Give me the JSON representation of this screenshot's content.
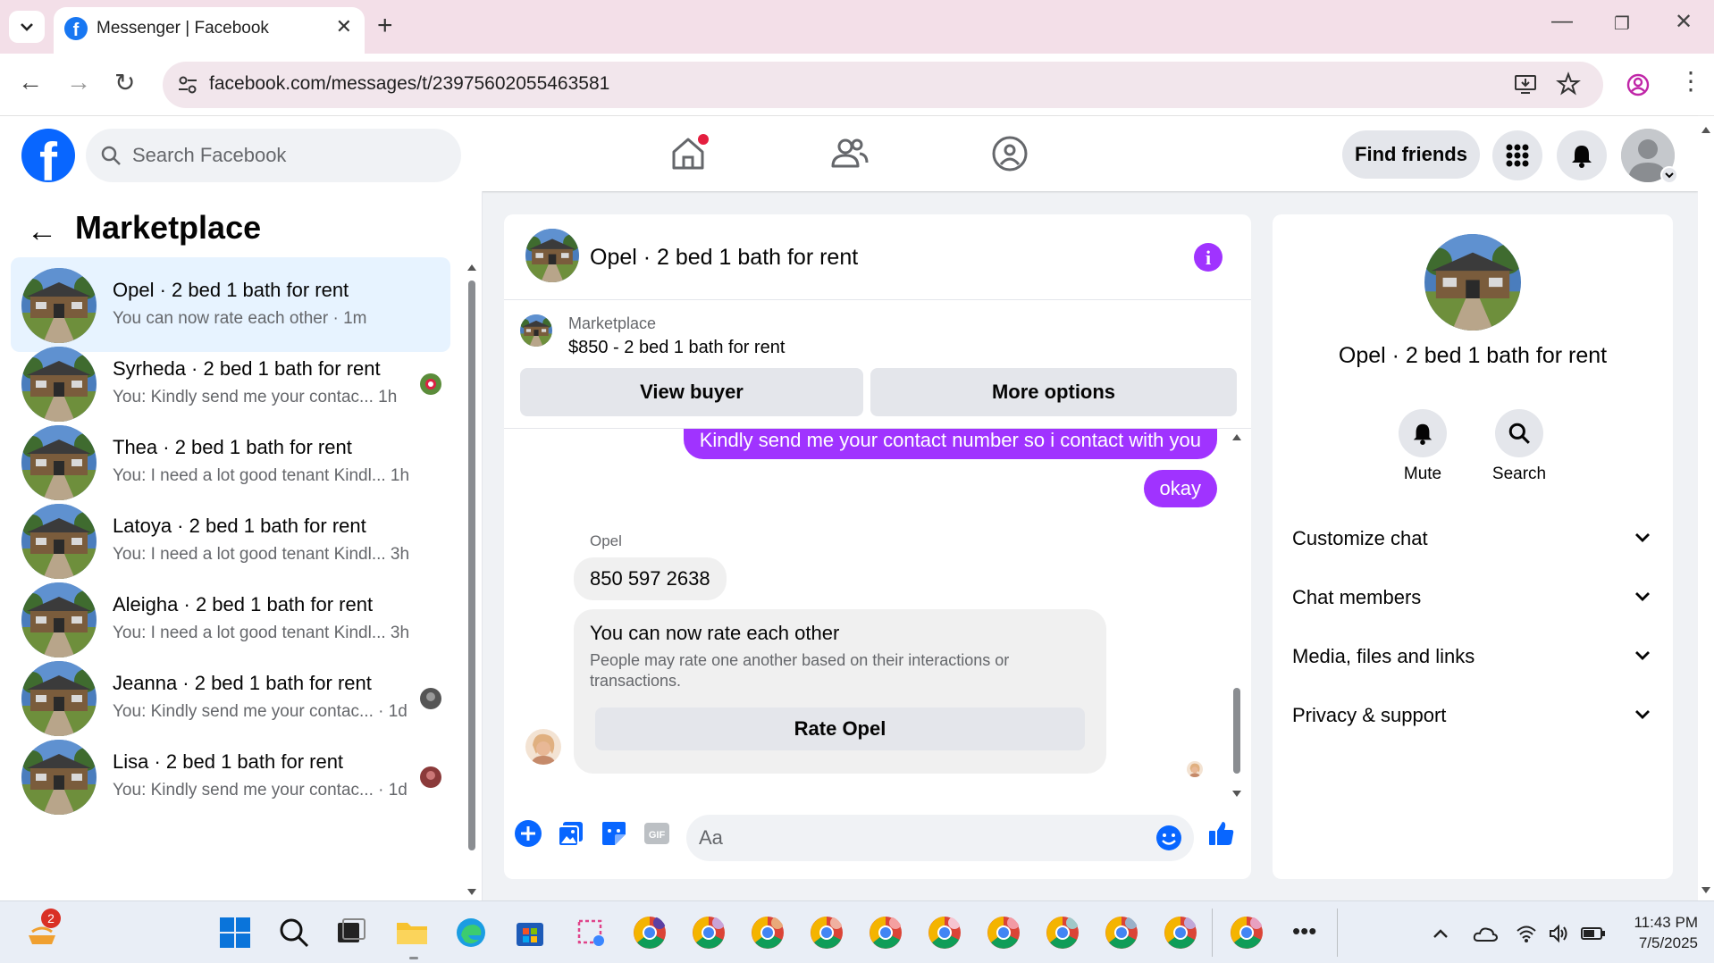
{
  "browser": {
    "tab_title": "Messenger | Facebook",
    "url": "facebook.com/messages/t/23975602055463581"
  },
  "header": {
    "search_placeholder": "Search Facebook",
    "find_friends_label": "Find friends"
  },
  "sidebar": {
    "title": "Marketplace",
    "conversations": [
      {
        "title": "Opel · 2 bed 1 bath for rent",
        "preview": "You can now rate each other · 1m",
        "active": true
      },
      {
        "title": "Syrheda · 2 bed 1 bath for rent",
        "preview": "You: Kindly send me your contac...  1h"
      },
      {
        "title": "Thea · 2 bed 1 bath for rent",
        "preview": "You: I need a lot good tenant Kindl...  1h"
      },
      {
        "title": "Latoya · 2 bed 1 bath for rent",
        "preview": "You: I need a lot good tenant Kindl...  3h"
      },
      {
        "title": "Aleigha · 2 bed 1 bath for rent",
        "preview": "You: I need a lot good tenant Kindl...  3h"
      },
      {
        "title": "Jeanna · 2 bed 1 bath for rent",
        "preview": "You: Kindly send me your contac... · 1d"
      },
      {
        "title": "Lisa · 2 bed 1 bath for rent",
        "preview": "You: Kindly send me your contac... · 1d"
      }
    ]
  },
  "chat": {
    "title": "Opel · 2 bed 1 bath for rent",
    "listing_label": "Marketplace",
    "listing_price": "$850 - 2 bed 1 bath for rent",
    "view_buyer_label": "View buyer",
    "more_options_label": "More options",
    "messages": {
      "out_1": "Kindly send me your contact number so i contact with you",
      "out_2": "okay",
      "sender_name": "Opel",
      "in_1": "850 597 2638"
    },
    "rate_card": {
      "title": "You can now rate each other",
      "description": "People may rate one another based on their interactions or transactions.",
      "button": "Rate Opel"
    },
    "composer_placeholder": "Aa"
  },
  "info_panel": {
    "name": "Opel · 2 bed 1 bath for rent",
    "mute_label": "Mute",
    "search_label": "Search",
    "rows": [
      "Customize chat",
      "Chat members",
      "Media, files and links",
      "Privacy & support"
    ]
  },
  "taskbar": {
    "notification_badge": "2",
    "time": "11:43 PM",
    "date": "7/5/2025"
  },
  "colors": {
    "fb_blue": "#0866ff",
    "messenger_purple": "#a033ff",
    "active_conv_bg": "#e7f3ff"
  }
}
